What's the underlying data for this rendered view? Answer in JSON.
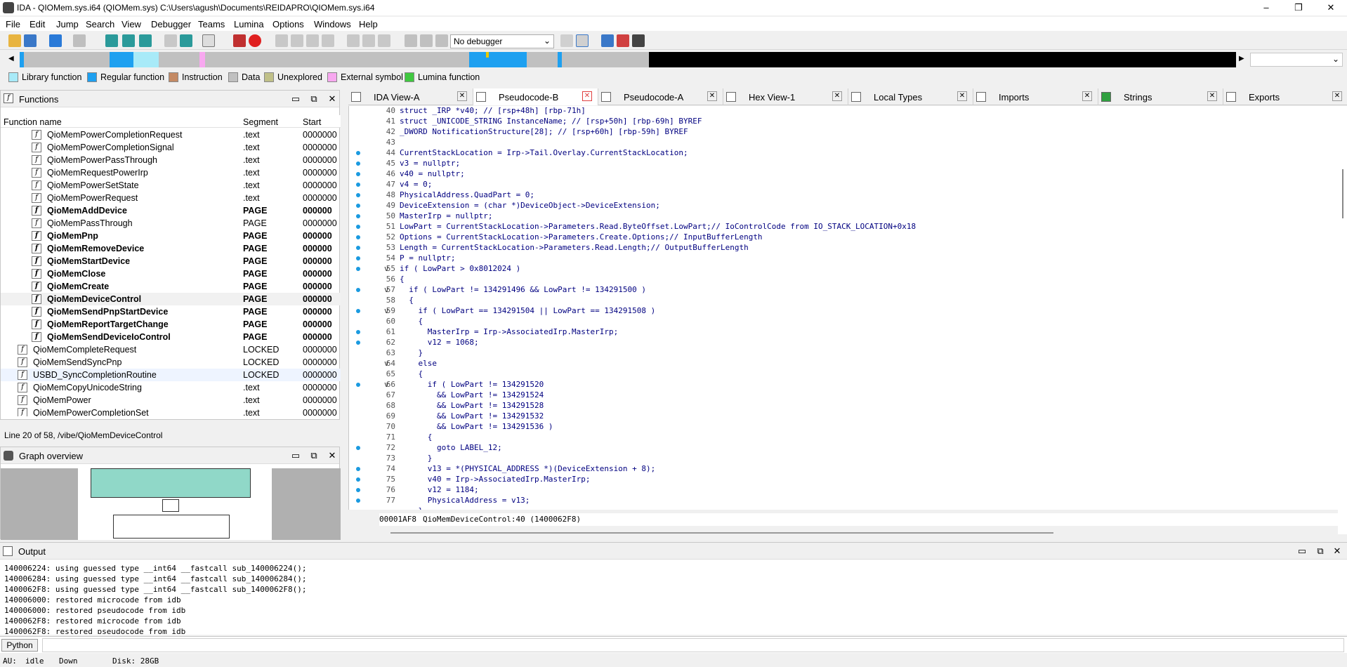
{
  "window": {
    "title": "IDA - QIOMem.sys.i64 (QIOMem.sys) C:\\Users\\agush\\Documents\\REIDAPRO\\QIOMem.sys.i64"
  },
  "menu": [
    "File",
    "Edit",
    "Jump",
    "Search",
    "View",
    "Debugger",
    "Teams",
    "Lumina",
    "Options",
    "Windows",
    "Help"
  ],
  "toolbar": {
    "debugger": "No debugger"
  },
  "legend": [
    {
      "label": "Library function",
      "color": "#a8eaf8"
    },
    {
      "label": "Regular function",
      "color": "#1ea0f0"
    },
    {
      "label": "Instruction",
      "color": "#c48a64"
    },
    {
      "label": "Data",
      "color": "#c0c0c0"
    },
    {
      "label": "Unexplored",
      "color": "#c0c088"
    },
    {
      "label": "External symbol",
      "color": "#f8a8f0"
    },
    {
      "label": "Lumina function",
      "color": "#40c840"
    }
  ],
  "functions": {
    "title": "Functions",
    "col_name": "Function name",
    "col_segment": "Segment",
    "col_start": "Start",
    "rows": [
      {
        "name": "QioMemPowerCompletionRequest",
        "segment": ".text",
        "start": "0000000",
        "bold": false,
        "indent": true
      },
      {
        "name": "QioMemPowerCompletionSignal",
        "segment": ".text",
        "start": "0000000",
        "bold": false,
        "indent": true
      },
      {
        "name": "QioMemPowerPassThrough",
        "segment": ".text",
        "start": "0000000",
        "bold": false,
        "indent": true
      },
      {
        "name": "QioMemRequestPowerIrp",
        "segment": ".text",
        "start": "0000000",
        "bold": false,
        "indent": true
      },
      {
        "name": "QioMemPowerSetState",
        "segment": ".text",
        "start": "0000000",
        "bold": false,
        "indent": true
      },
      {
        "name": "QioMemPowerRequest",
        "segment": ".text",
        "start": "0000000",
        "bold": false,
        "indent": true
      },
      {
        "name": "QioMemAddDevice",
        "segment": "PAGE",
        "start": "000000",
        "bold": true,
        "indent": true
      },
      {
        "name": "QioMemPassThrough",
        "segment": "PAGE",
        "start": "0000000",
        "bold": false,
        "indent": true
      },
      {
        "name": "QioMemPnp",
        "segment": "PAGE",
        "start": "000000",
        "bold": true,
        "indent": true
      },
      {
        "name": "QioMemRemoveDevice",
        "segment": "PAGE",
        "start": "000000",
        "bold": true,
        "indent": true
      },
      {
        "name": "QioMemStartDevice",
        "segment": "PAGE",
        "start": "000000",
        "bold": true,
        "indent": true
      },
      {
        "name": "QioMemClose",
        "segment": "PAGE",
        "start": "000000",
        "bold": true,
        "indent": true
      },
      {
        "name": "QioMemCreate",
        "segment": "PAGE",
        "start": "000000",
        "bold": true,
        "indent": true
      },
      {
        "name": "QioMemDeviceControl",
        "segment": "PAGE",
        "start": "000000",
        "bold": true,
        "indent": true
      },
      {
        "name": "QioMemSendPnpStartDevice",
        "segment": "PAGE",
        "start": "000000",
        "bold": true,
        "indent": true
      },
      {
        "name": "QioMemReportTargetChange",
        "segment": "PAGE",
        "start": "000000",
        "bold": true,
        "indent": true
      },
      {
        "name": "QioMemSendDeviceIoControl",
        "segment": "PAGE",
        "start": "000000",
        "bold": true,
        "indent": true
      },
      {
        "name": "QioMemCompleteRequest",
        "segment": "LOCKED",
        "start": "0000000",
        "bold": false,
        "indent": false
      },
      {
        "name": "QioMemSendSyncPnp",
        "segment": "LOCKED",
        "start": "0000000",
        "bold": false,
        "indent": false
      },
      {
        "name": "USBD_SyncCompletionRoutine",
        "segment": "LOCKED",
        "start": "0000000",
        "bold": false,
        "indent": false
      },
      {
        "name": "QioMemCopyUnicodeString",
        "segment": ".text",
        "start": "0000000",
        "bold": false,
        "indent": false
      },
      {
        "name": "QioMemPower",
        "segment": ".text",
        "start": "0000000",
        "bold": false,
        "indent": false
      },
      {
        "name": "QioMemPowerCompletionSet",
        "segment": ".text",
        "start": "0000000",
        "bold": false,
        "indent": false
      }
    ],
    "status": "Line 20 of 58, /vibe/QioMemDeviceControl"
  },
  "graph": {
    "title": "Graph overview"
  },
  "tabs": [
    "IDA View-A",
    "Pseudocode-B",
    "Pseudocode-A",
    "Hex View-1",
    "Local Types",
    "Imports",
    "Strings",
    "Exports"
  ],
  "code": {
    "lines": [
      {
        "n": "40",
        "t": "struct _IRP *v40; // [rsp+48h] [rbp-71h]",
        "dot": false,
        "fold": ""
      },
      {
        "n": "41",
        "t": "struct _UNICODE_STRING InstanceName; // [rsp+50h] [rbp-69h] BYREF",
        "dot": false,
        "fold": ""
      },
      {
        "n": "42",
        "t": "_DWORD NotificationStructure[28]; // [rsp+60h] [rbp-59h] BYREF",
        "dot": false,
        "fold": ""
      },
      {
        "n": "43",
        "t": "",
        "dot": false,
        "fold": ""
      },
      {
        "n": "44",
        "t": "CurrentStackLocation = Irp->Tail.Overlay.CurrentStackLocation;",
        "dot": true,
        "fold": ""
      },
      {
        "n": "45",
        "t": "v3 = nullptr;",
        "dot": true,
        "fold": ""
      },
      {
        "n": "46",
        "t": "v40 = nullptr;",
        "dot": true,
        "fold": ""
      },
      {
        "n": "47",
        "t": "v4 = 0;",
        "dot": true,
        "fold": ""
      },
      {
        "n": "48",
        "t": "PhysicalAddress.QuadPart = 0;",
        "dot": true,
        "fold": ""
      },
      {
        "n": "49",
        "t": "DeviceExtension = (char *)DeviceObject->DeviceExtension;",
        "dot": true,
        "fold": ""
      },
      {
        "n": "50",
        "t": "MasterIrp = nullptr;",
        "dot": true,
        "fold": ""
      },
      {
        "n": "51",
        "t": "LowPart = CurrentStackLocation->Parameters.Read.ByteOffset.LowPart;// IoControlCode from IO_STACK_LOCATION+0x18",
        "dot": true,
        "fold": ""
      },
      {
        "n": "52",
        "t": "Options = CurrentStackLocation->Parameters.Create.Options;// InputBufferLength",
        "dot": true,
        "fold": ""
      },
      {
        "n": "53",
        "t": "Length = CurrentStackLocation->Parameters.Read.Length;// OutputBufferLength",
        "dot": true,
        "fold": ""
      },
      {
        "n": "54",
        "t": "P = nullptr;",
        "dot": true,
        "fold": ""
      },
      {
        "n": "55",
        "t": "if ( LowPart > 0x8012024 )",
        "dot": true,
        "fold": "v"
      },
      {
        "n": "56",
        "t": "{",
        "dot": false,
        "fold": ""
      },
      {
        "n": "57",
        "t": "  if ( LowPart != 134291496 && LowPart != 134291500 )",
        "dot": true,
        "fold": "v"
      },
      {
        "n": "58",
        "t": "  {",
        "dot": false,
        "fold": ""
      },
      {
        "n": "59",
        "t": "    if ( LowPart == 134291504 || LowPart == 134291508 )",
        "dot": true,
        "fold": "v"
      },
      {
        "n": "60",
        "t": "    {",
        "dot": false,
        "fold": ""
      },
      {
        "n": "61",
        "t": "      MasterIrp = Irp->AssociatedIrp.MasterIrp;",
        "dot": true,
        "fold": ""
      },
      {
        "n": "62",
        "t": "      v12 = 1068;",
        "dot": true,
        "fold": ""
      },
      {
        "n": "63",
        "t": "    }",
        "dot": false,
        "fold": ""
      },
      {
        "n": "64",
        "t": "    else",
        "dot": false,
        "fold": "v"
      },
      {
        "n": "65",
        "t": "    {",
        "dot": false,
        "fold": ""
      },
      {
        "n": "66",
        "t": "      if ( LowPart != 134291520",
        "dot": true,
        "fold": "v"
      },
      {
        "n": "67",
        "t": "        && LowPart != 134291524",
        "dot": false,
        "fold": ""
      },
      {
        "n": "68",
        "t": "        && LowPart != 134291528",
        "dot": false,
        "fold": ""
      },
      {
        "n": "69",
        "t": "        && LowPart != 134291532",
        "dot": false,
        "fold": ""
      },
      {
        "n": "70",
        "t": "        && LowPart != 134291536 )",
        "dot": false,
        "fold": ""
      },
      {
        "n": "71",
        "t": "      {",
        "dot": false,
        "fold": ""
      },
      {
        "n": "72",
        "t": "        goto LABEL_12;",
        "dot": true,
        "fold": ""
      },
      {
        "n": "73",
        "t": "      }",
        "dot": false,
        "fold": ""
      },
      {
        "n": "74",
        "t": "      v13 = *(PHYSICAL_ADDRESS *)(DeviceExtension + 8);",
        "dot": true,
        "fold": ""
      },
      {
        "n": "75",
        "t": "      v40 = Irp->AssociatedIrp.MasterIrp;",
        "dot": true,
        "fold": ""
      },
      {
        "n": "76",
        "t": "      v12 = 1184;",
        "dot": true,
        "fold": ""
      },
      {
        "n": "77",
        "t": "      PhysicalAddress = v13;",
        "dot": true,
        "fold": ""
      },
      {
        "n": "",
        "t": "    }",
        "dot": false,
        "fold": ""
      }
    ],
    "status_addr": "00001AF8",
    "status_loc": "QioMemDeviceControl:40 (1400062F8)"
  },
  "output": {
    "title": "Output",
    "lines": [
      "140006224: using guessed type __int64 __fastcall sub_140006224();",
      "140006284: using guessed type __int64 __fastcall sub_140006284();",
      "1400062F8: using guessed type __int64 __fastcall sub_1400062F8();",
      "140006000: restored microcode from idb",
      "140006000: restored pseudocode from idb",
      "1400062F8: restored microcode from idb",
      "1400062F8: restored pseudocode from idb"
    ]
  },
  "python": {
    "label": "Python"
  },
  "status": {
    "au": "AU:",
    "state": "idle",
    "dir": "Down",
    "disk": "Disk: 28GB"
  }
}
